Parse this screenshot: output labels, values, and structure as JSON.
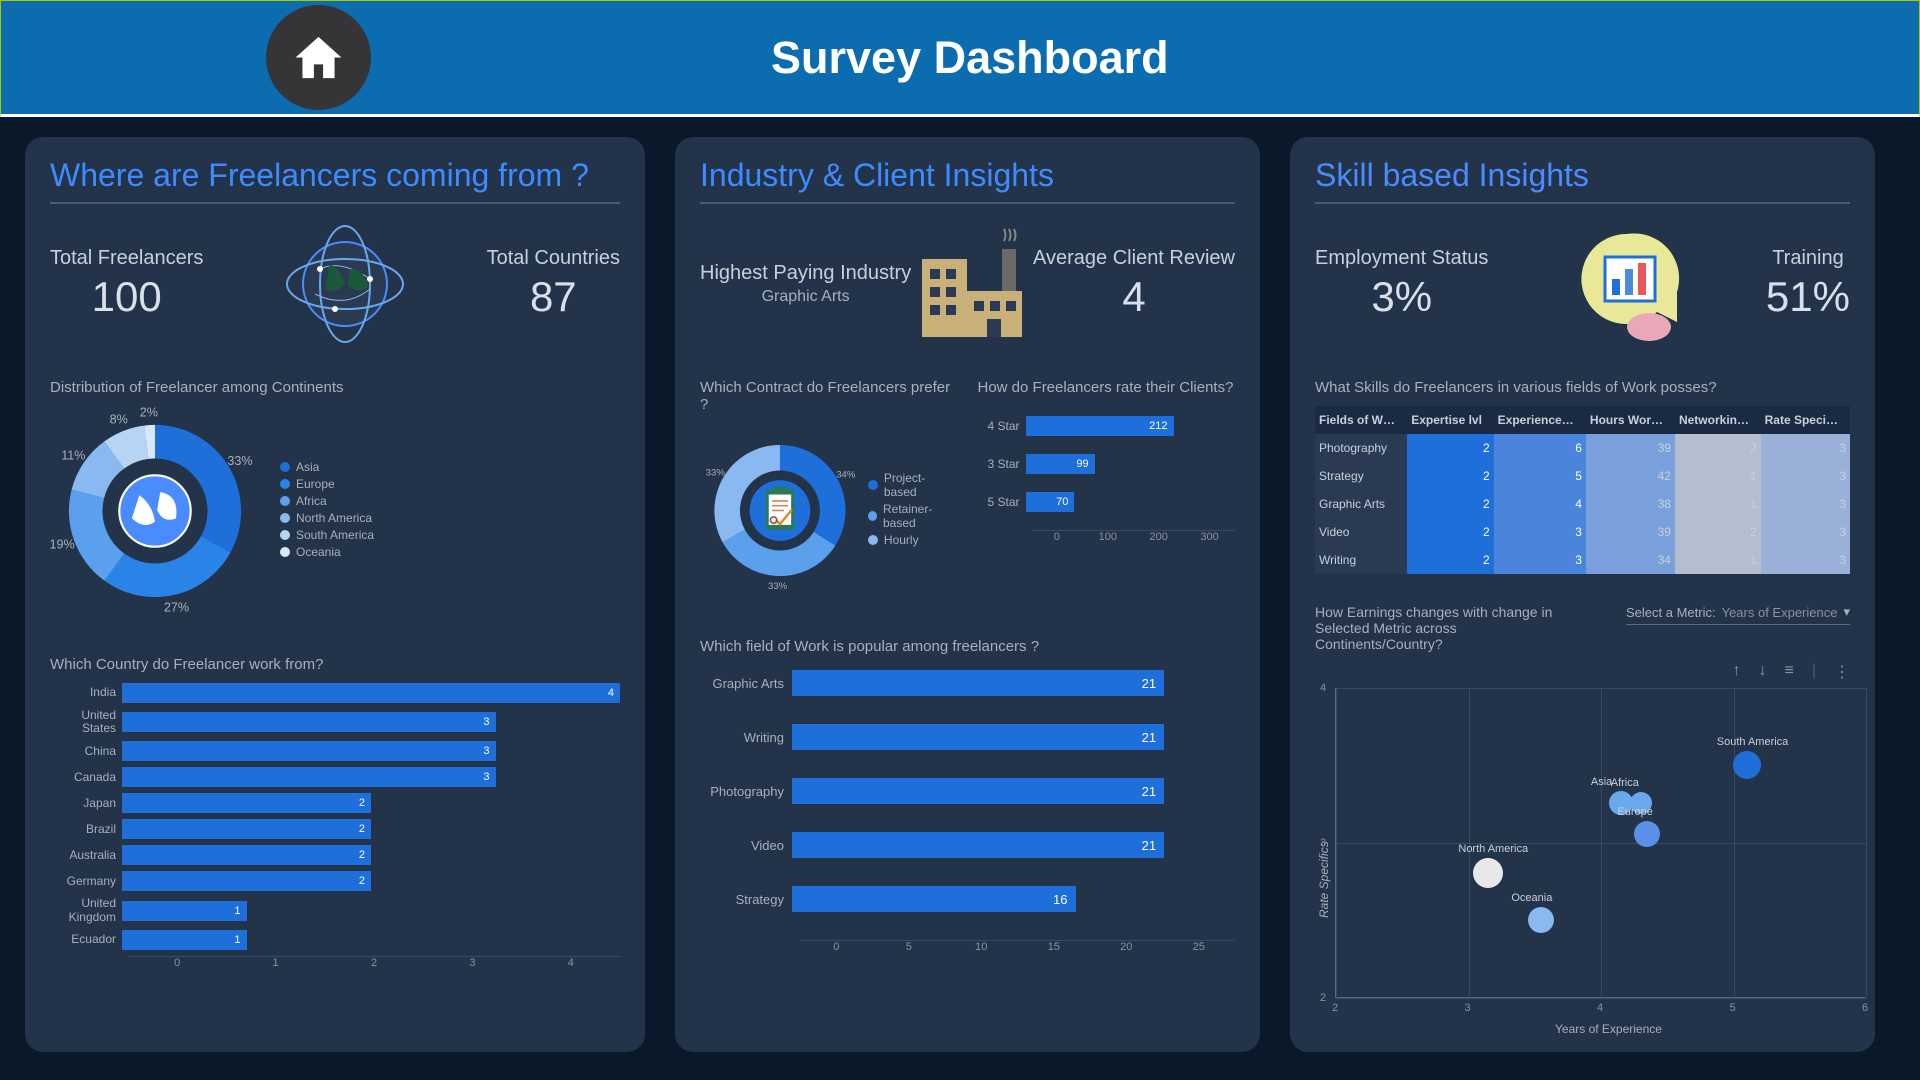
{
  "header": {
    "title": "Survey Dashboard"
  },
  "panel_left": {
    "title": "Where are Freelancers coming from ?",
    "kpi1_label": "Total Freelancers",
    "kpi1_value": "100",
    "kpi2_label": "Total Countries",
    "kpi2_value": "87",
    "donut_title": "Distribution of Freelancer among Continents",
    "country_title": "Which Country do Freelancer work from?"
  },
  "panel_mid": {
    "title": "Industry & Client Insights",
    "kpi1_label": "Highest Paying Industry",
    "kpi1_sub": "Graphic Arts",
    "kpi2_label": "Average Client Review",
    "kpi2_value": "4",
    "donut_title": "Which Contract do Freelancers prefer ?",
    "rating_title": "How do Freelancers rate their Clients?",
    "field_title": "Which field of Work is popular among freelancers ?"
  },
  "panel_right": {
    "title": "Skill based Insights",
    "kpi1_label": "Employment Status",
    "kpi1_value": "3%",
    "kpi2_label": "Training",
    "kpi2_value": "51%",
    "skills_title": "What Skills do Freelancers in various fields of Work posses?",
    "scatter_title": "How Earnings changes with change in Selected Metric across Continents/Country?",
    "select_label": "Select a Metric:",
    "select_value": "Years of Experience",
    "xlabel": "Years of Experience",
    "ylabel": "Rate Specifics"
  },
  "chart_data": [
    {
      "type": "pie",
      "title": "Distribution of Freelancer among Continents",
      "series": [
        {
          "name": "Asia",
          "value": 33,
          "color": "#1e6fd9"
        },
        {
          "name": "Europe",
          "value": 27,
          "color": "#2a84e8"
        },
        {
          "name": "Africa",
          "value": 19,
          "color": "#5aa0ec"
        },
        {
          "name": "North America",
          "value": 11,
          "color": "#8ab8f0"
        },
        {
          "name": "South America",
          "value": 8,
          "color": "#b8d4f4"
        },
        {
          "name": "Oceania",
          "value": 2,
          "color": "#d8e8f8"
        }
      ]
    },
    {
      "type": "bar",
      "title": "Which Country do Freelancer work from?",
      "orientation": "horizontal",
      "categories": [
        "India",
        "United States",
        "China",
        "Canada",
        "Japan",
        "Brazil",
        "Australia",
        "Germany",
        "United Kingdom",
        "Ecuador"
      ],
      "values": [
        4,
        3,
        3,
        3,
        2,
        2,
        2,
        2,
        1,
        1
      ],
      "xlim": [
        0,
        4
      ]
    },
    {
      "type": "pie",
      "title": "Which Contract do Freelancers prefer ?",
      "series": [
        {
          "name": "Project-based",
          "value": 34,
          "color": "#1e6fd9"
        },
        {
          "name": "Retainer-based",
          "value": 33,
          "color": "#5aa0ec"
        },
        {
          "name": "Hourly",
          "value": 33,
          "color": "#8ab8f0"
        }
      ]
    },
    {
      "type": "bar",
      "title": "How do Freelancers rate their Clients?",
      "orientation": "horizontal",
      "categories": [
        "4 Star",
        "3 Star",
        "5 Star"
      ],
      "values": [
        212,
        99,
        70
      ],
      "xlim": [
        0,
        300
      ]
    },
    {
      "type": "bar",
      "title": "Which field of Work is popular among freelancers ?",
      "orientation": "horizontal",
      "categories": [
        "Graphic Arts",
        "Writing",
        "Photography",
        "Video",
        "Strategy"
      ],
      "values": [
        21,
        21,
        21,
        21,
        16
      ],
      "xlim": [
        0,
        25
      ]
    },
    {
      "type": "heatmap",
      "title": "What Skills do Freelancers in various fields of Work posses?",
      "columns": [
        "Fields of W…",
        "Expertise lvl",
        "Experience…",
        "Hours Wor…",
        "Networkin…",
        "Rate Speci…"
      ],
      "rows": [
        {
          "field": "Photography",
          "vals": [
            2,
            6,
            39,
            2,
            3
          ]
        },
        {
          "field": "Strategy",
          "vals": [
            2,
            5,
            42,
            1,
            3
          ]
        },
        {
          "field": "Graphic Arts",
          "vals": [
            2,
            4,
            38,
            1,
            3
          ]
        },
        {
          "field": "Video",
          "vals": [
            2,
            3,
            39,
            2,
            3
          ]
        },
        {
          "field": "Writing",
          "vals": [
            2,
            3,
            34,
            1,
            3
          ]
        }
      ]
    },
    {
      "type": "scatter",
      "title": "How Earnings changes with change in Selected Metric across Continents/Country?",
      "xlabel": "Years of Experience",
      "ylabel": "Rate Specifics",
      "xlim": [
        2,
        6
      ],
      "ylim": [
        2,
        4
      ],
      "points": [
        {
          "name": "South America",
          "x": 5.1,
          "y": 3.5,
          "size": 28,
          "color": "#1e6fd9"
        },
        {
          "name": "Asia",
          "x": 4.15,
          "y": 3.25,
          "size": 24,
          "color": "#6aa8ec"
        },
        {
          "name": "Africa",
          "x": 4.3,
          "y": 3.25,
          "size": 22,
          "color": "#6aa8ec"
        },
        {
          "name": "Europe",
          "x": 4.35,
          "y": 3.05,
          "size": 26,
          "color": "#5a90e8"
        },
        {
          "name": "North America",
          "x": 3.15,
          "y": 2.8,
          "size": 30,
          "color": "#e8e8e8"
        },
        {
          "name": "Oceania",
          "x": 3.55,
          "y": 2.5,
          "size": 26,
          "color": "#8ab8f0"
        }
      ]
    }
  ]
}
